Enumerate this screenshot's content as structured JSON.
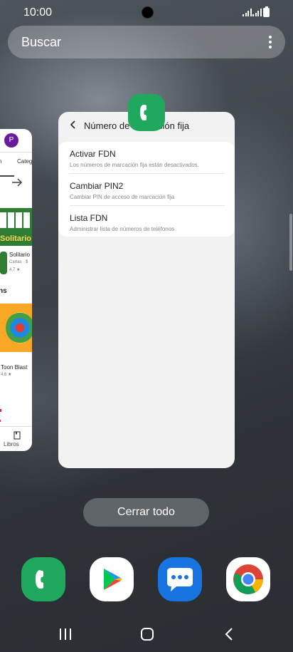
{
  "status_bar": {
    "time": "10:00"
  },
  "search": {
    "placeholder": "Buscar"
  },
  "left_card": {
    "tab_fragment": "n",
    "tab_categories": "Categ",
    "avatar_initial": "P",
    "banner_text": "Solitario",
    "app1": {
      "name": "Solitario",
      "category": "Cartas · $",
      "rating": "4,7 ★"
    },
    "section_fragment": "ns",
    "app2": {
      "name": "Toon Blast",
      "rating": "4,6 ★"
    },
    "books_label": "Libros"
  },
  "main_card": {
    "title": "Número de marcación fija",
    "items": [
      {
        "title": "Activar FDN",
        "subtitle": "Los números de marcación fija están desactivados."
      },
      {
        "title": "Cambiar PIN2",
        "subtitle": "Cambiar PIN de acceso de marcación fija"
      },
      {
        "title": "Lista FDN",
        "subtitle": "Administrar lista de números de teléfonos"
      }
    ]
  },
  "close_all": {
    "label": "Cerrar todo"
  },
  "dock": {
    "apps": [
      "phone-icon",
      "play-store-icon",
      "messages-icon",
      "chrome-icon"
    ]
  },
  "colors": {
    "phone_green": "#1fa85e",
    "messages_blue": "#1874e0",
    "close_button": "#5f6469"
  }
}
